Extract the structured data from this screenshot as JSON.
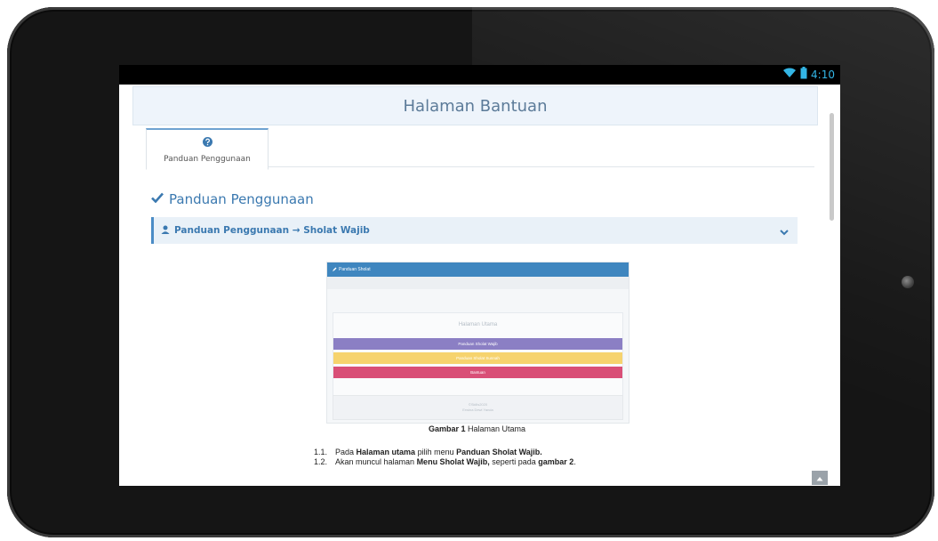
{
  "status_bar": {
    "time": "4:10",
    "icons": [
      "wifi-icon",
      "battery-icon"
    ]
  },
  "header": {
    "title": "Halaman Bantuan"
  },
  "tabs": [
    {
      "label": "Panduan Penggunaan",
      "icon": "question-circle-icon"
    }
  ],
  "section": {
    "title": "Panduan Penggunaan",
    "icon": "check-icon"
  },
  "accordion": {
    "title": "Panduan Penggunaan → Sholat Wajib",
    "icon": "user-icon",
    "expanded": true
  },
  "figure": {
    "mock": {
      "app_title": "Panduan Sholat",
      "page_title": "Halaman Utama",
      "buttons": [
        {
          "label": "Panduan Sholat Wajib",
          "color": "#8b7fc4"
        },
        {
          "label": "Panduan Sholat Sunnah",
          "color": "#f6d36e"
        },
        {
          "label": "Bantuan",
          "color": "#d94f77"
        }
      ],
      "footer_lines": [
        "©Skills2020",
        "Erwina Dewi Yanda"
      ]
    },
    "caption_bold": "Gambar 1",
    "caption_rest": " Halaman Utama"
  },
  "steps": [
    {
      "num": "1.1.",
      "parts": [
        {
          "t": "Pada ",
          "b": false
        },
        {
          "t": "Halaman utama",
          "b": true
        },
        {
          "t": " pilih menu ",
          "b": false
        },
        {
          "t": "Panduan Sholat Wajib.",
          "b": true
        }
      ]
    },
    {
      "num": "1.2.",
      "parts": [
        {
          "t": "Akan muncul halaman ",
          "b": false
        },
        {
          "t": "Menu Sholat Wajib,",
          "b": true
        },
        {
          "t": " seperti pada ",
          "b": false
        },
        {
          "t": "gambar 2",
          "b": true
        },
        {
          "t": ".",
          "b": false
        }
      ]
    }
  ],
  "colors": {
    "accent": "#3b79b0",
    "header_bg": "#eef4fb",
    "tab_top": "#6fa3d1",
    "status_accent": "#33b5e5"
  }
}
